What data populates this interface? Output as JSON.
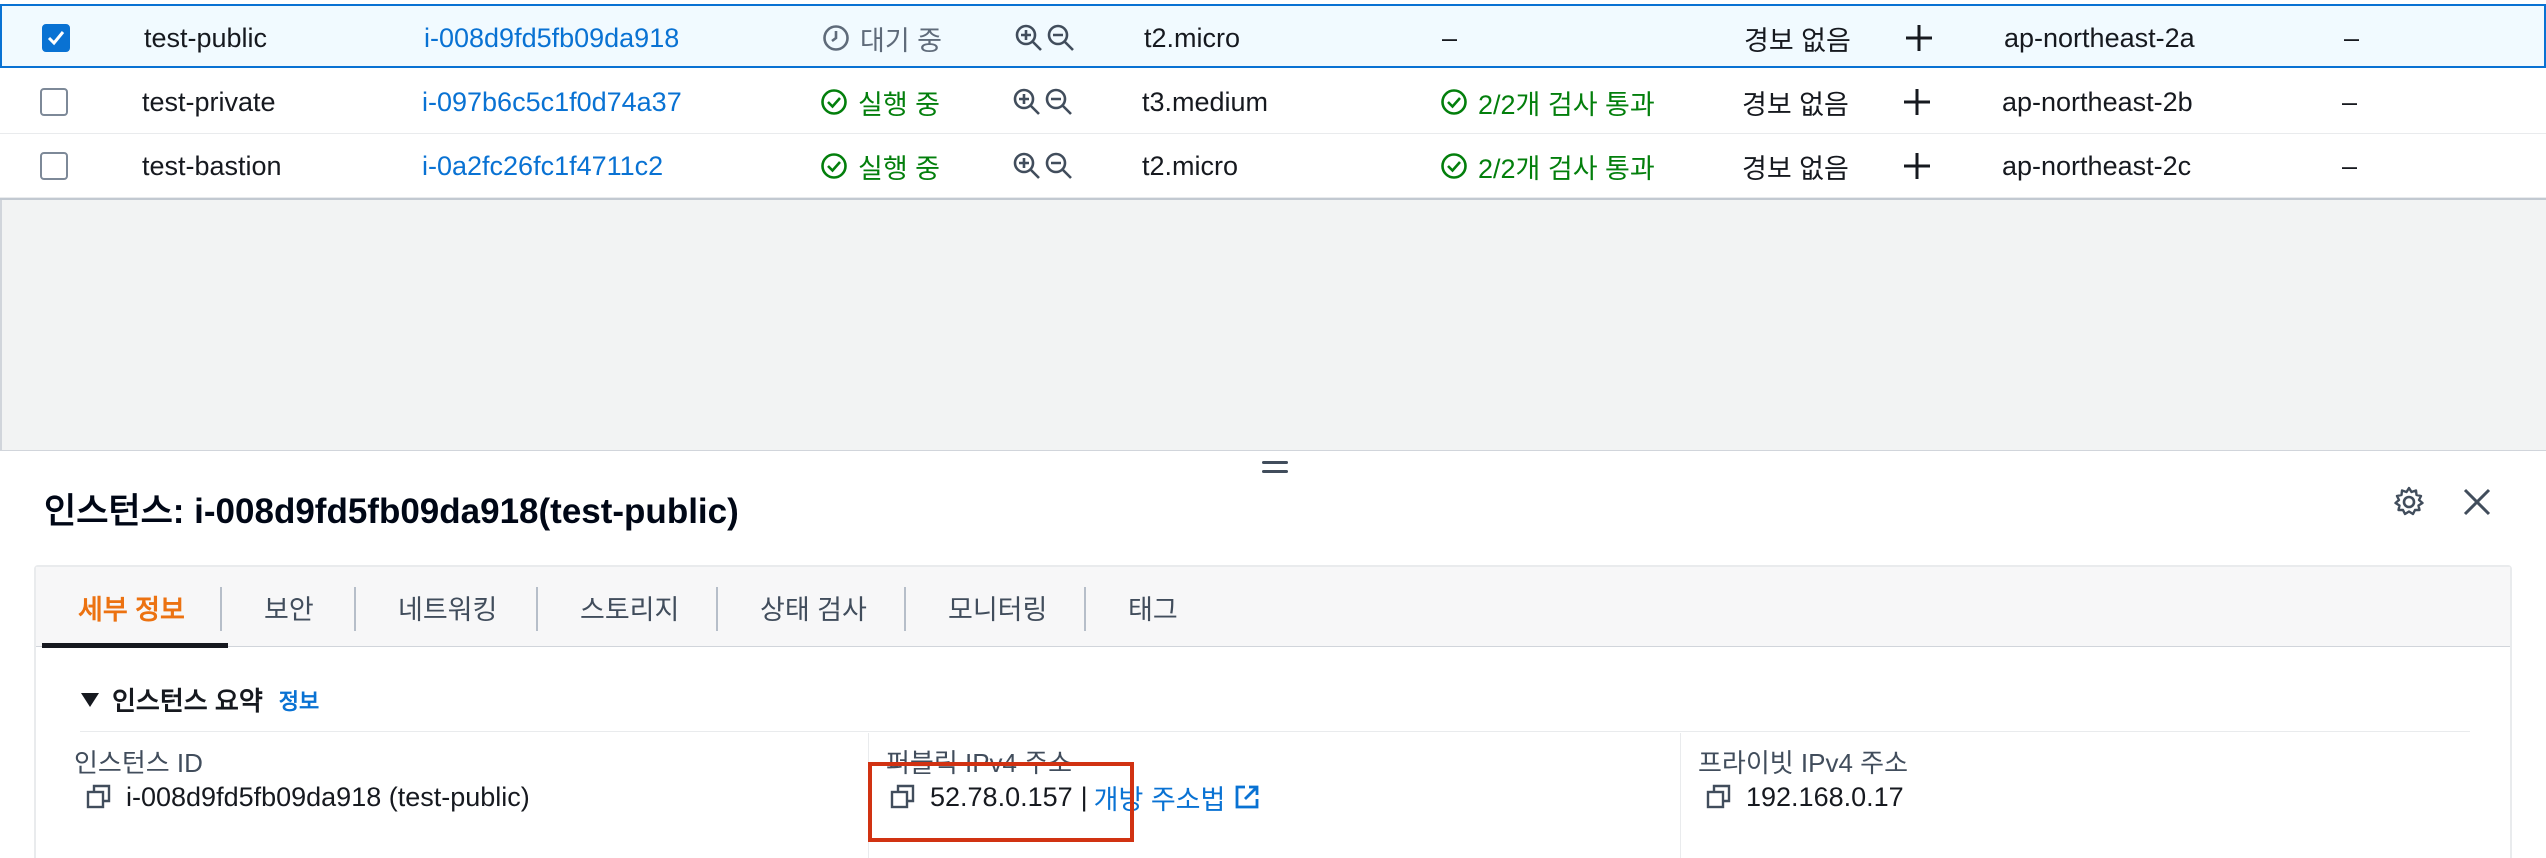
{
  "rows": [
    {
      "name": "test-public",
      "id": "i-008d9fd5fb09da918",
      "state": "대기 중",
      "state_kind": "pending",
      "type": "t2.micro",
      "check": "–",
      "alarm": "경보 없음",
      "az": "ap-northeast-2a",
      "ip": "–",
      "checked": true
    },
    {
      "name": "test-private",
      "id": "i-097b6c5c1f0d74a37",
      "state": "실행 중",
      "state_kind": "running",
      "type": "t3.medium",
      "check": "2/2개 검사 통과",
      "alarm": "경보 없음",
      "az": "ap-northeast-2b",
      "ip": "–",
      "checked": false
    },
    {
      "name": "test-bastion",
      "id": "i-0a2fc26fc1f4711c2",
      "state": "실행 중",
      "state_kind": "running",
      "type": "t2.micro",
      "check": "2/2개 검사 통과",
      "alarm": "경보 없음",
      "az": "ap-northeast-2c",
      "ip": "–",
      "checked": false
    }
  ],
  "panel": {
    "title": "인스턴스: i-008d9fd5fb09da918(test-public)",
    "tabs": [
      "세부 정보",
      "보안",
      "네트워킹",
      "스토리지",
      "상태 검사",
      "모니터링",
      "태그"
    ],
    "active_tab": "세부 정보",
    "summary_title": "인스턴스 요약",
    "summary_info": "정보",
    "fields": {
      "instance_id_label": "인스턴스 ID",
      "instance_id_value": "i-008d9fd5fb09da918 (test-public)",
      "public_ip_label": "퍼블릭 IPv4 주소",
      "public_ip_value": "52.78.0.157",
      "public_ip_sep": "|",
      "public_ip_link": "개방 주소법",
      "private_ip_label": "프라이빗 IPv4 주소",
      "private_ip_value": "192.168.0.17"
    }
  },
  "colors": {
    "accent": "#0972d3",
    "active_tab": "#ec7211",
    "success": "#037f0c",
    "highlight": "#d13212"
  },
  "icons": [
    "checkbox-icon",
    "clock-icon",
    "check-circle-icon",
    "zoom-in-icon",
    "zoom-out-icon",
    "plus-icon",
    "gear-icon",
    "close-icon",
    "copy-icon",
    "external-link-icon",
    "caret-down-icon",
    "drag-handle-icon"
  ]
}
